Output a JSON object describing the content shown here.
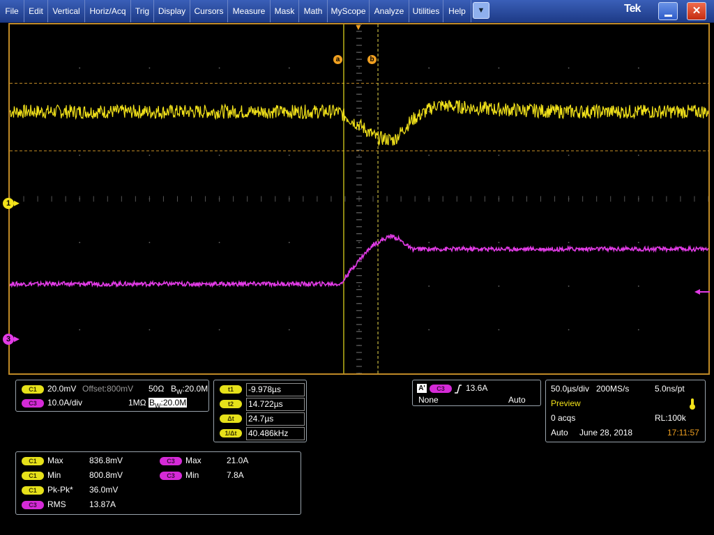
{
  "menu": {
    "items": [
      "File",
      "Edit",
      "Vertical",
      "Horiz/Acq",
      "Trig",
      "Display",
      "Cursors",
      "Measure",
      "Mask",
      "Math",
      "MyScope",
      "Analyze",
      "Utilities",
      "Help"
    ],
    "dropdown_glyph": "▼",
    "logo": "Tek",
    "minimize_icon": "minimize-icon",
    "close_icon": "✕"
  },
  "colors": {
    "ch1": "#f2e21a",
    "ch3": "#e23be6",
    "frame": "#c08a26",
    "cursor_a": "#e8e01e",
    "cursor_b": "#c5b840",
    "cursor_label": "#f0a020"
  },
  "scope": {
    "cursor_a_label": "a",
    "cursor_b_label": "b",
    "ch1_marker": "1",
    "ch3_marker": "3",
    "trigger_marker": "▼"
  },
  "channels": {
    "c1": {
      "tag": "C1",
      "scale": "20.0mV",
      "offset": "Offset:800mV",
      "impedance": "50Ω",
      "bw_prefix": "B",
      "bw_sub": "W",
      "bw": ":20.0M"
    },
    "c3": {
      "tag": "C3",
      "scale": "10.0A/div",
      "impedance": "1MΩ",
      "bw_prefix": "B",
      "bw_sub": "W",
      "bw": ":20.0M"
    }
  },
  "cursors": {
    "rows": [
      {
        "label": "t1",
        "value": "-9.978µs"
      },
      {
        "label": "t2",
        "value": "14.722µs"
      },
      {
        "label": "Δt",
        "value": "24.7µs"
      },
      {
        "label": "1/Δt",
        "value": "40.486kHz"
      }
    ]
  },
  "trigger": {
    "a_label": "A'",
    "source": "C3",
    "slope_icon": "rising-edge-icon",
    "level": "13.6A",
    "coupling": "None",
    "mode": "Auto"
  },
  "acquisition": {
    "timebase": "50.0µs/div",
    "sample_rate": "200MS/s",
    "resolution": "5.0ns/pt",
    "state": "Preview",
    "acqs": "0 acqs",
    "record_length": "RL:100k",
    "trigger_mode": "Auto",
    "date": "June 28, 2018",
    "time": "17:11:57"
  },
  "measurements": {
    "left": [
      {
        "src": "C1",
        "name": "Max",
        "value": "836.8mV"
      },
      {
        "src": "C1",
        "name": "Min",
        "value": "800.8mV"
      },
      {
        "src": "C1",
        "name": "Pk-Pk*",
        "value": "36.0mV"
      },
      {
        "src": "C3",
        "name": "RMS",
        "value": "13.87A"
      }
    ],
    "right": [
      {
        "src": "C3",
        "name": "Max",
        "value": "21.0A"
      },
      {
        "src": "C3",
        "name": "Min",
        "value": "7.8A"
      }
    ]
  },
  "chart_data": {
    "type": "line",
    "title": "",
    "x_unit": "div",
    "xlim": [
      0,
      10
    ],
    "ylim": [
      -4,
      4
    ],
    "grid": true,
    "series": [
      {
        "name": "C1",
        "x": [
          0,
          4.7,
          5.0,
          5.25,
          5.5,
          5.75,
          6.1,
          6.5,
          7.0,
          8.0,
          10.0
        ],
        "y": [
          2.0,
          2.0,
          1.7,
          1.4,
          1.35,
          1.8,
          2.15,
          2.1,
          2.05,
          2.0,
          2.0
        ]
      },
      {
        "name": "C3",
        "x": [
          0,
          4.75,
          4.8,
          5.0,
          5.2,
          5.45,
          5.55,
          5.75,
          6.0,
          8.0,
          10.0
        ],
        "y": [
          -1.95,
          -1.95,
          -1.8,
          -1.4,
          -1.05,
          -0.85,
          -0.9,
          -1.15,
          -1.15,
          -1.15,
          -1.15
        ]
      }
    ]
  }
}
